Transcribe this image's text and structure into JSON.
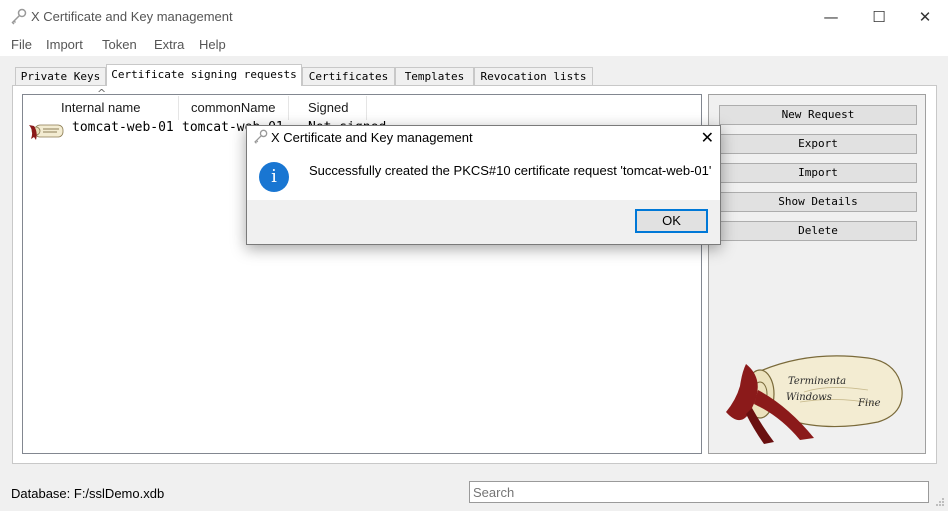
{
  "window": {
    "title": "X Certificate and Key management",
    "minimize_glyph": "—",
    "maximize_glyph": "☐",
    "close_glyph": "✕"
  },
  "menu": {
    "items": [
      "File",
      "Import",
      "Token",
      "Extra",
      "Help"
    ]
  },
  "tabs": [
    {
      "label": "Private Keys"
    },
    {
      "label": "Certificate signing requests",
      "active": true
    },
    {
      "label": "Certificates"
    },
    {
      "label": "Templates"
    },
    {
      "label": "Revocation lists"
    }
  ],
  "list": {
    "columns": [
      "Internal name",
      "commonName",
      "Signed"
    ],
    "sort_indicator": "^",
    "rows": [
      {
        "internal_name": "tomcat-web-01",
        "common_name": "tomcat-web-01",
        "signed": "Not signed"
      }
    ]
  },
  "side_buttons": [
    "New Request",
    "Export",
    "Import",
    "Show Details",
    "Delete"
  ],
  "logo": {
    "text_line1": "Terminenta",
    "text_line2": "Windows",
    "text_line3": "Fine"
  },
  "status": {
    "database": "Database: F:/sslDemo.xdb"
  },
  "search": {
    "placeholder": "Search"
  },
  "dialog": {
    "title": "X Certificate and Key management",
    "close_glyph": "✕",
    "info_glyph": "i",
    "message": "Successfully created the PKCS#10 certificate request 'tomcat-web-01'",
    "ok_label": "OK"
  },
  "colors": {
    "accent": "#0078d7",
    "info_icon": "#1976d2",
    "ribbon": "#8b1a1a",
    "scroll_paper": "#f3ecd2"
  }
}
